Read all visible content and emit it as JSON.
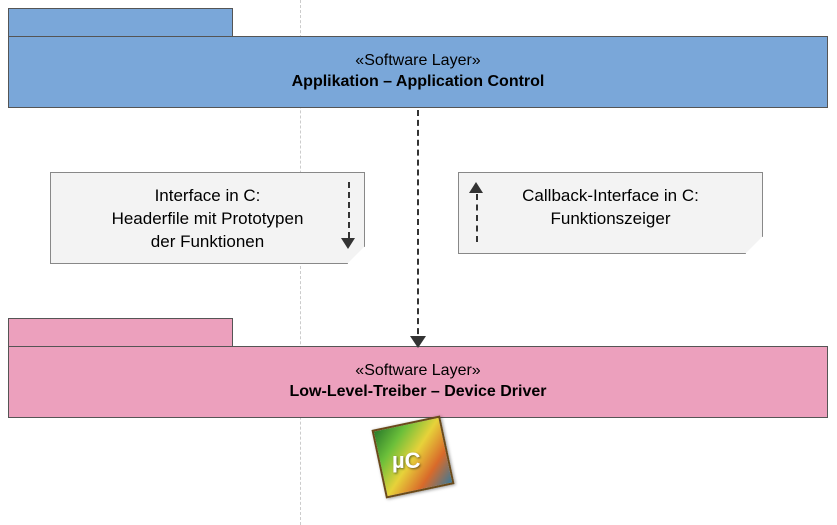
{
  "layers": {
    "app": {
      "stereotype": "«Software Layer»",
      "name": "Applikation – Application Control"
    },
    "driver": {
      "stereotype": "«Software Layer»",
      "name": "Low-Level-Treiber – Device Driver"
    }
  },
  "notes": {
    "left": {
      "line1": "Interface in C:",
      "line2": "Headerfile mit Prototypen",
      "line3": "der Funktionen"
    },
    "right": {
      "line1": "Callback-Interface in C:",
      "line2": "Funktionszeiger"
    }
  },
  "chip": {
    "label": "µC"
  }
}
